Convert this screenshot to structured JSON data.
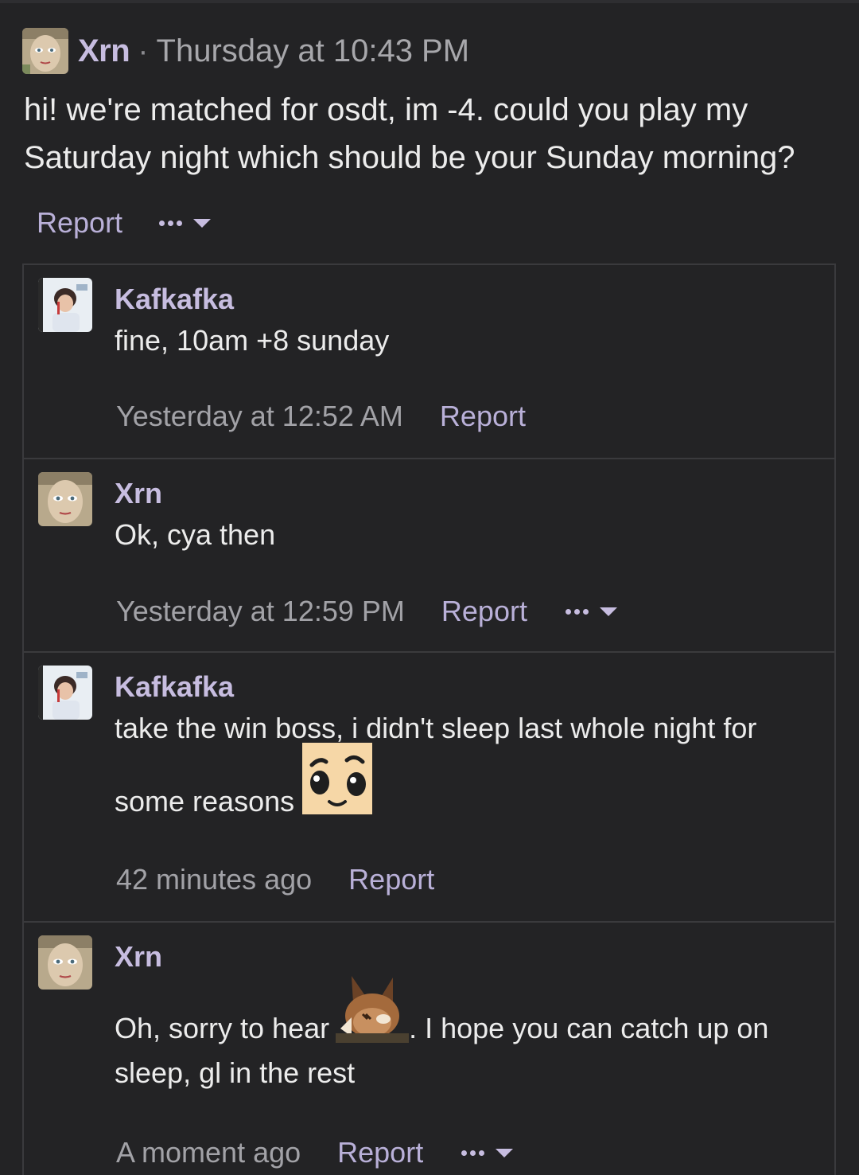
{
  "post": {
    "author": "Xrn",
    "separator": "·",
    "time": "Thursday at 10:43 PM",
    "body": "hi! we're matched for osdt, im -4. could you play my Saturday night which should be your Sunday morning?",
    "report_label": "Report"
  },
  "replies": [
    {
      "author": "Kafkafka",
      "text": "fine, 10am +8 sunday",
      "time": "Yesterday at 12:52 AM",
      "report_label": "Report"
    },
    {
      "author": "Xrn",
      "text": "Ok, cya then",
      "time": "Yesterday at 12:59 PM",
      "report_label": "Report"
    },
    {
      "author": "Kafkafka",
      "text_line1": "take the win boss, i didn't sleep last whole night for",
      "text_line2": "some reasons",
      "time": "42 minutes ago",
      "report_label": "Report"
    },
    {
      "author": "Xrn",
      "text_part1": "Oh, sorry to hear",
      "text_part2": ". I hope you can catch up on",
      "text_line2": "sleep, gl in the rest",
      "time": "A moment ago",
      "report_label": "Report"
    }
  ],
  "colors": {
    "background": "#232325",
    "username": "#c7bde0",
    "link": "#b9b0d8",
    "muted": "#a7a7ab",
    "border": "#3a3a3d"
  },
  "icons": {
    "more": "more-dots-icon",
    "dropdown": "caret-down-icon",
    "emoji_pleading": "pleading-face-emoji",
    "emoji_eevee": "eevee-facepalm-emoji"
  }
}
